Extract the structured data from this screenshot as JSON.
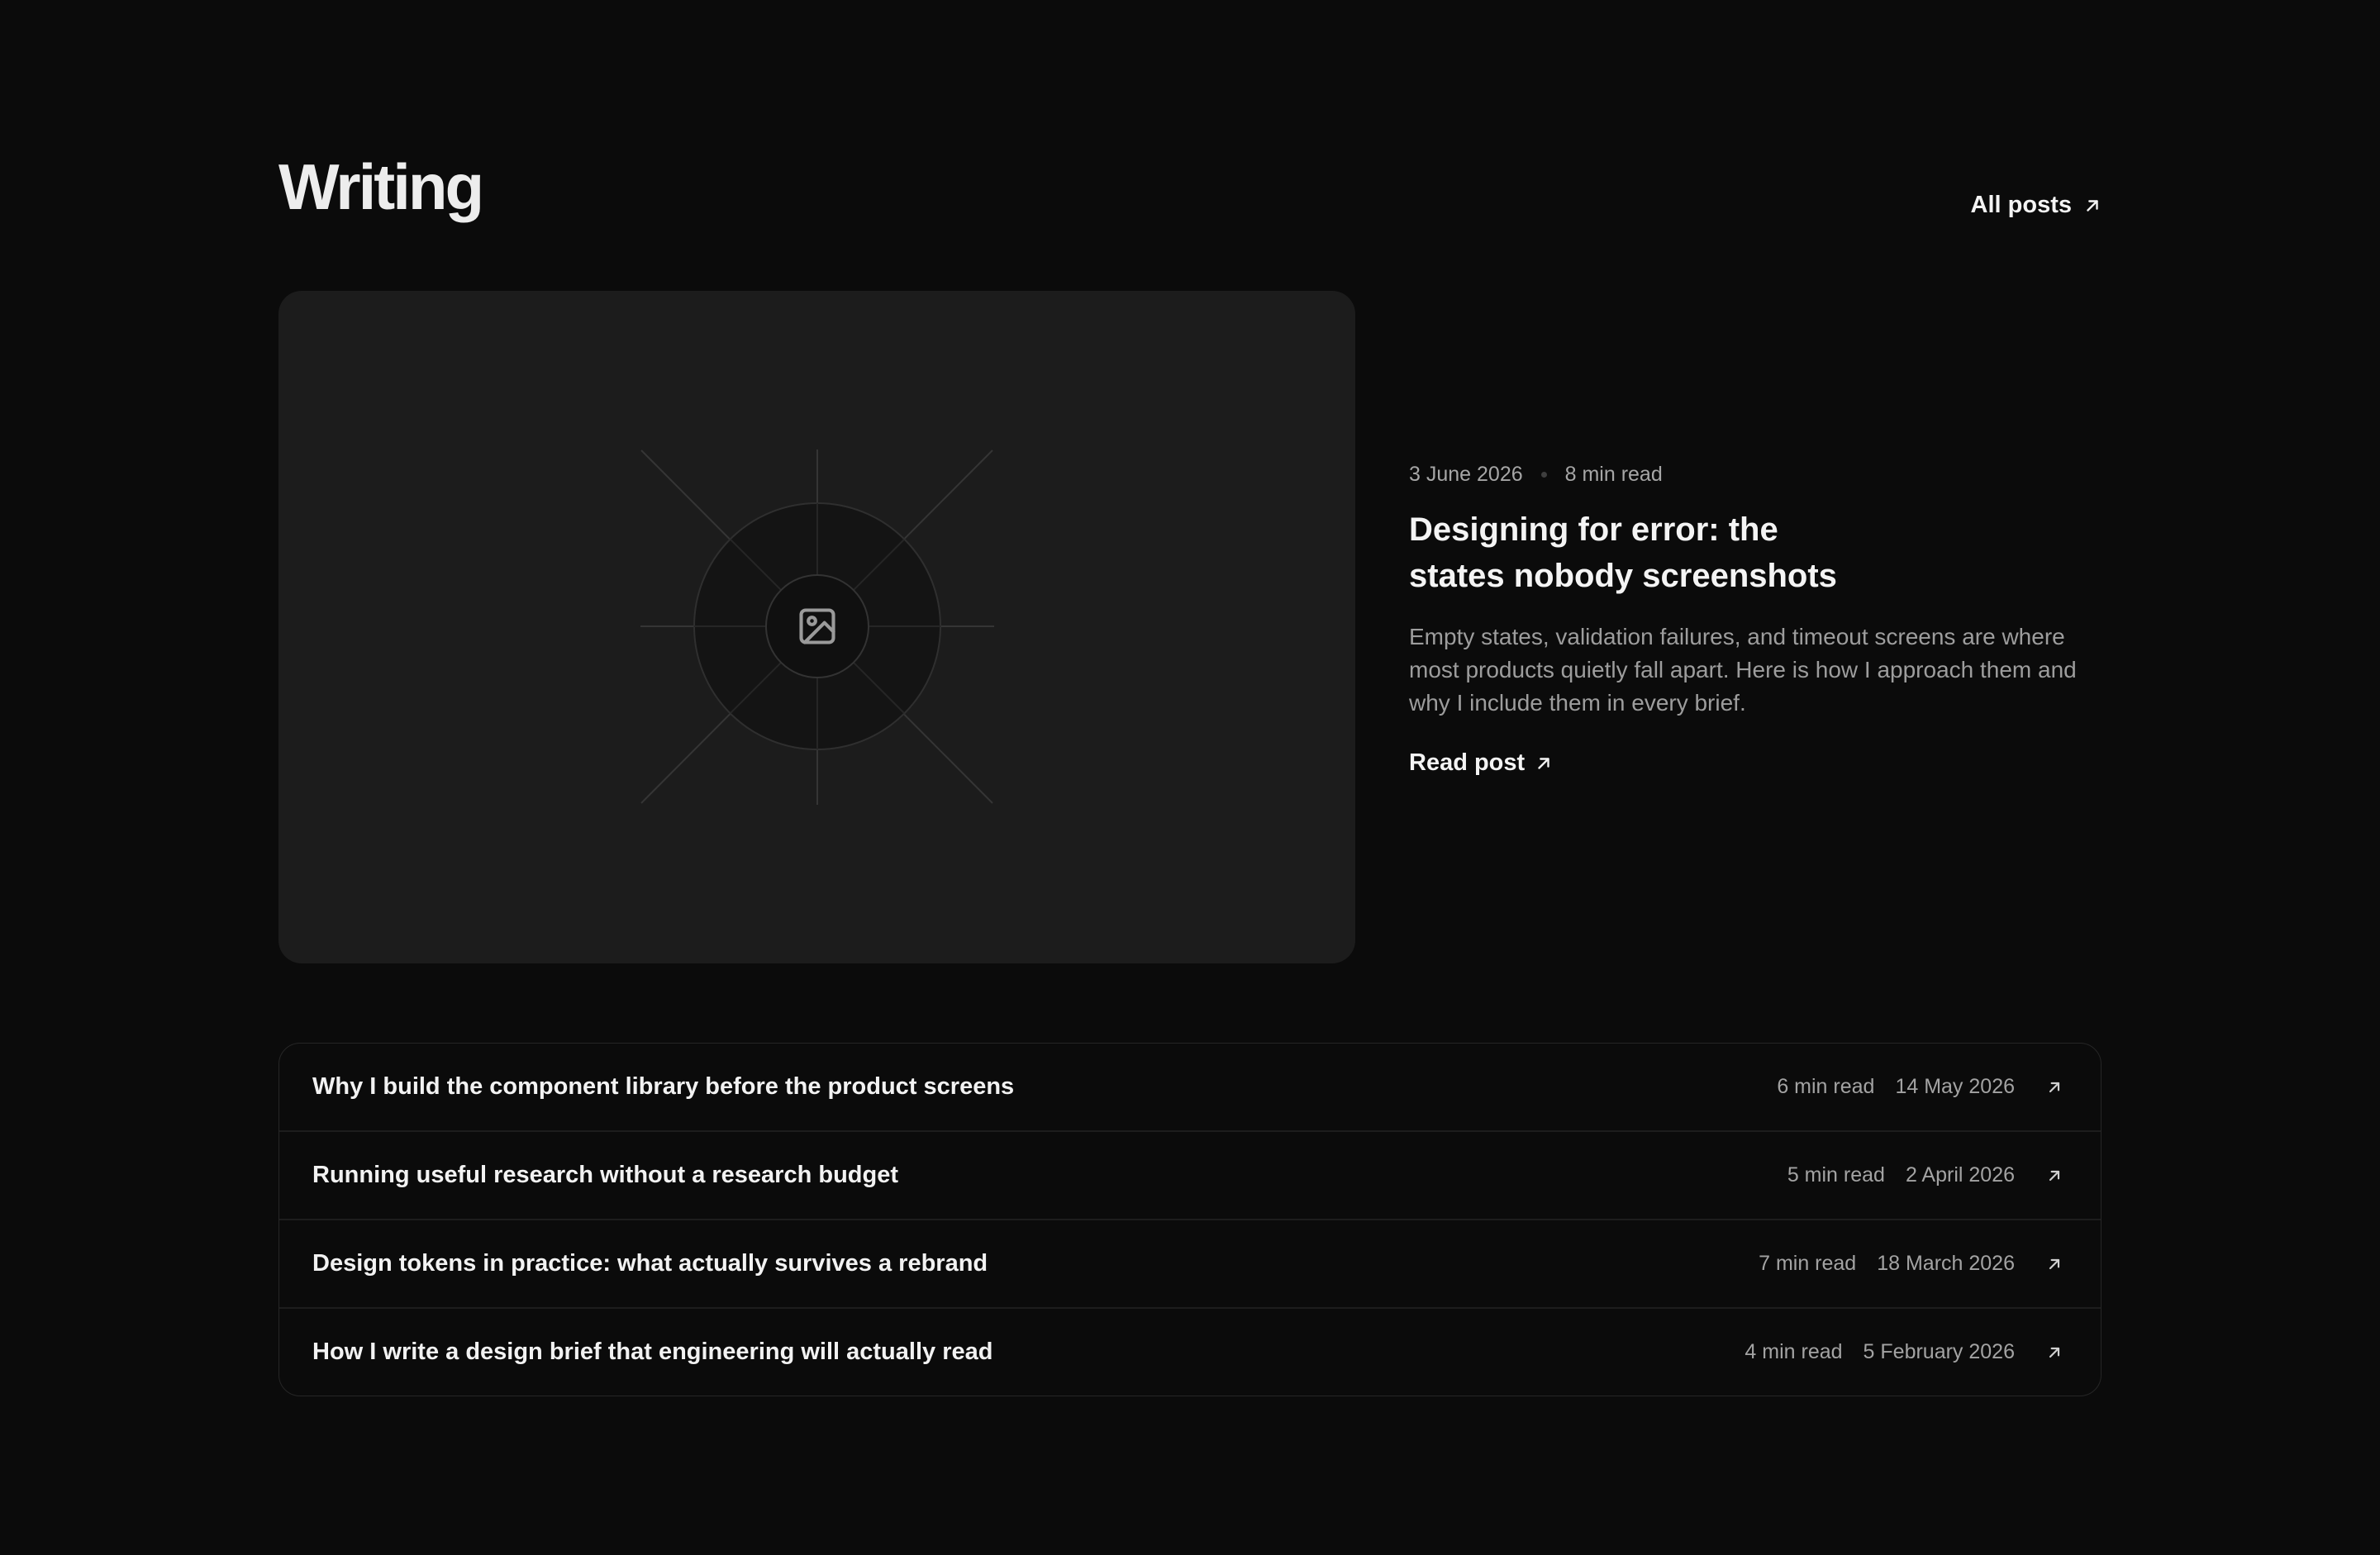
{
  "header": {
    "title": "Writing",
    "all_posts_label": "All posts"
  },
  "featured": {
    "date": "3 June 2026",
    "read_time": "8 min read",
    "title_line1": "Designing for error: the",
    "title_line2": "states nobody screenshots",
    "excerpt": "Empty states, validation failures, and timeout screens are where most products quietly fall apart. Here is how I approach them and why I include them in every brief.",
    "read_label": "Read post",
    "image_icon": "image-icon"
  },
  "posts": [
    {
      "title": "Why I build the component library before the product screens",
      "read_time": "6 min read",
      "date": "14 May 2026"
    },
    {
      "title": "Running useful research without a research budget",
      "read_time": "5 min read",
      "date": "2 April 2026"
    },
    {
      "title": "Design tokens in practice: what actually survives a rebrand",
      "read_time": "7 min read",
      "date": "18 March 2026"
    },
    {
      "title": "How I write a design brief that engineering will actually read",
      "read_time": "4 min read",
      "date": "5 February 2026"
    }
  ],
  "icons": {
    "link": "arrow-up-right-icon"
  },
  "colors": {
    "background": "#0b0b0b",
    "card": "#1c1c1c",
    "text": "#f2f2f2",
    "muted": "#a3a3a3",
    "border": "#262626"
  }
}
